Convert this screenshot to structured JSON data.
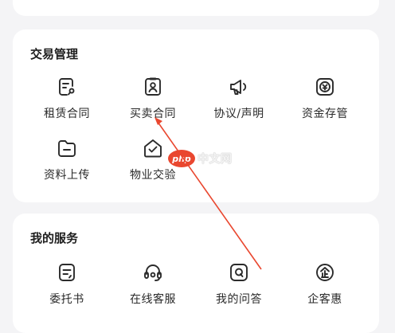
{
  "trade": {
    "title": "交易管理",
    "items": [
      {
        "label": "租赁合同",
        "icon": "lease-contract-icon"
      },
      {
        "label": "买卖合同",
        "icon": "sale-contract-icon"
      },
      {
        "label": "协议/声明",
        "icon": "announcement-icon"
      },
      {
        "label": "资金存管",
        "icon": "fund-custody-icon"
      },
      {
        "label": "资料上传",
        "icon": "folder-upload-icon"
      },
      {
        "label": "物业交验",
        "icon": "house-check-icon"
      }
    ]
  },
  "service": {
    "title": "我的服务",
    "items": [
      {
        "label": "委托书",
        "icon": "entrust-icon"
      },
      {
        "label": "在线客服",
        "icon": "headset-icon"
      },
      {
        "label": "我的问答",
        "icon": "qa-icon"
      },
      {
        "label": "企客惠",
        "icon": "enterprise-benefit-icon"
      }
    ]
  },
  "watermark": {
    "logo": "php",
    "text": "中文网"
  },
  "colors": {
    "accent": "#e9472f",
    "icon_stroke": "#2b2b2b",
    "background": "#f4f4f6"
  }
}
